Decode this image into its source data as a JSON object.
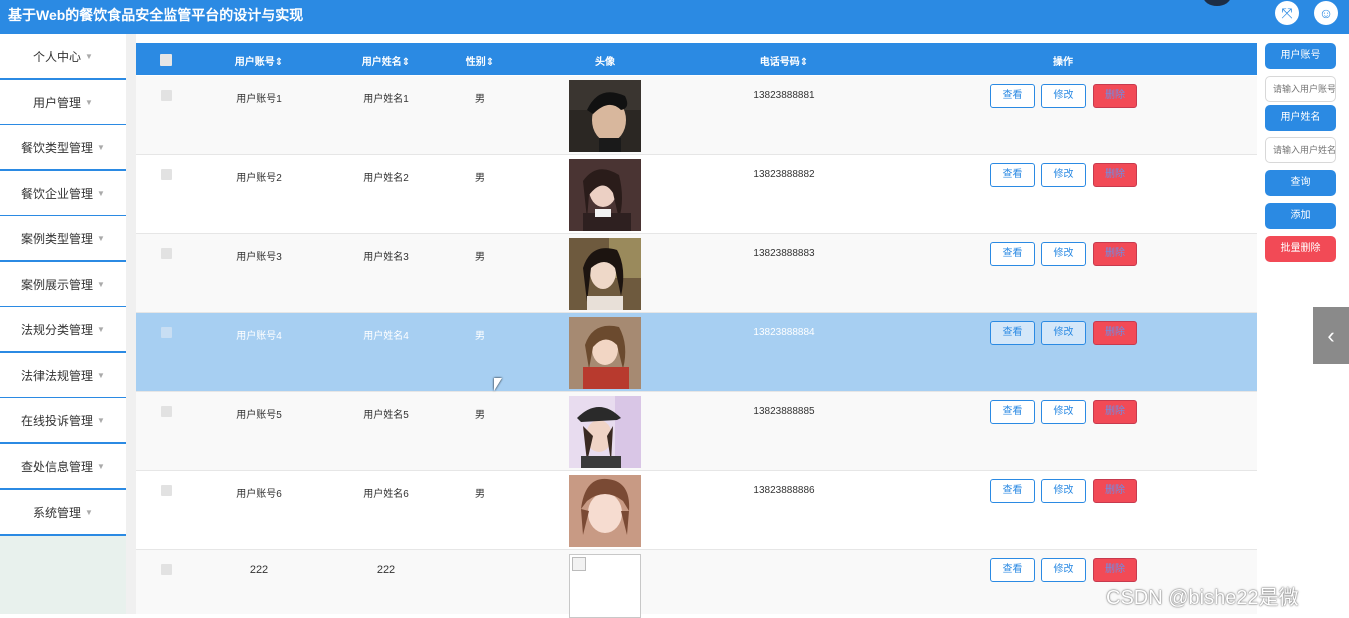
{
  "app": {
    "title": "基于Web的餐饮食品安全监管平台的设计与实现"
  },
  "topbar_icons": [
    {
      "name": "fullscreen-icon",
      "glyph": "⤧"
    },
    {
      "name": "user-icon",
      "glyph": "☺"
    }
  ],
  "sidebar": {
    "caret": "▼",
    "items": [
      {
        "label": "个人中心"
      },
      {
        "label": "用户管理"
      },
      {
        "label": "餐饮类型管理"
      },
      {
        "label": "餐饮企业管理"
      },
      {
        "label": "案例类型管理"
      },
      {
        "label": "案例展示管理"
      },
      {
        "label": "法规分类管理"
      },
      {
        "label": "法律法规管理"
      },
      {
        "label": "在线投诉管理"
      },
      {
        "label": "查处信息管理"
      },
      {
        "label": "系统管理"
      }
    ]
  },
  "table": {
    "headers": {
      "account": "用户账号⇕",
      "name": "用户姓名⇕",
      "gender": "性别⇕",
      "avatar": "头像",
      "phone": "电话号码⇕",
      "actions": "操作"
    },
    "rows": [
      {
        "account": "用户账号1",
        "name": "用户姓名1",
        "gender": "男",
        "phone": "13823888881",
        "avatar": "avatar-1",
        "highlighted": false
      },
      {
        "account": "用户账号2",
        "name": "用户姓名2",
        "gender": "男",
        "phone": "13823888882",
        "avatar": "avatar-2",
        "highlighted": false
      },
      {
        "account": "用户账号3",
        "name": "用户姓名3",
        "gender": "男",
        "phone": "13823888883",
        "avatar": "avatar-3",
        "highlighted": false
      },
      {
        "account": "用户账号4",
        "name": "用户姓名4",
        "gender": "男",
        "phone": "13823888884",
        "avatar": "avatar-4",
        "highlighted": true
      },
      {
        "account": "用户账号5",
        "name": "用户姓名5",
        "gender": "男",
        "phone": "13823888885",
        "avatar": "avatar-5",
        "highlighted": false
      },
      {
        "account": "用户账号6",
        "name": "用户姓名6",
        "gender": "男",
        "phone": "13823888886",
        "avatar": "avatar-6",
        "highlighted": false
      },
      {
        "account": "222",
        "name": "222",
        "gender": "",
        "phone": "",
        "avatar": "broken-image",
        "highlighted": false
      }
    ],
    "row_actions": {
      "view": "查看",
      "edit": "修改",
      "delete": "删除"
    }
  },
  "search_panel": {
    "account_label": "用户账号",
    "account_placeholder": "请输入用户账号",
    "name_label": "用户姓名",
    "name_placeholder": "请输入用户姓名",
    "query_label": "查询",
    "add_label": "添加",
    "batch_delete_label": "批量删除"
  },
  "collapse_glyph": "‹",
  "watermark": "CSDN @bishe22是微",
  "colors": {
    "primary": "#2b8ae3",
    "danger": "#f24a56",
    "row_highlight": "#a7cff2",
    "sidebar_bg": "#e8f1ed"
  }
}
